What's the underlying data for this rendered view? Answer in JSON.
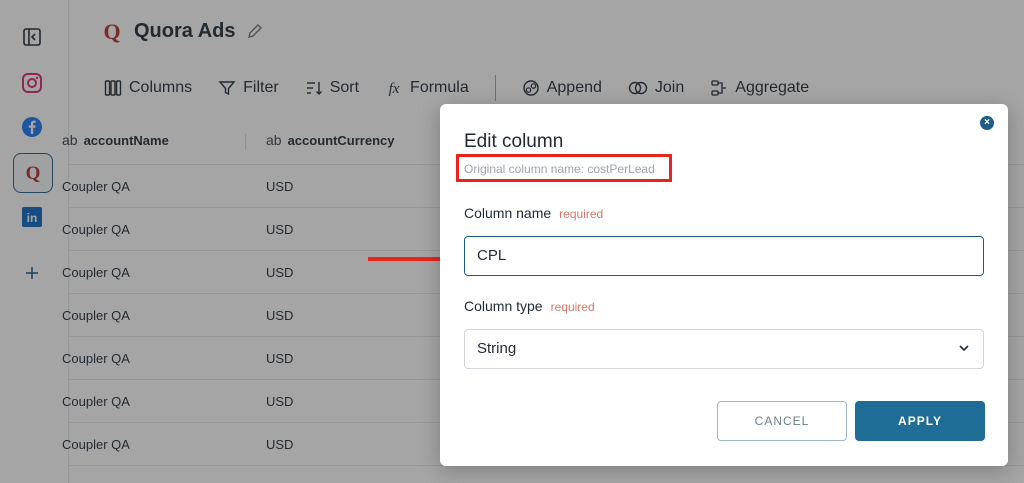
{
  "app": {
    "title": "Quora Ads"
  },
  "toolbar": {
    "columns": "Columns",
    "filter": "Filter",
    "sort": "Sort",
    "formula": "Formula",
    "append": "Append",
    "join": "Join",
    "aggregate": "Aggregate"
  },
  "table": {
    "headers": [
      {
        "type": "ab",
        "name": "accountName"
      },
      {
        "type": "ab",
        "name": "accountCurrency"
      }
    ],
    "rows": [
      {
        "accountName": "Coupler QA",
        "accountCurrency": "USD"
      },
      {
        "accountName": "Coupler QA",
        "accountCurrency": "USD"
      },
      {
        "accountName": "Coupler QA",
        "accountCurrency": "USD"
      },
      {
        "accountName": "Coupler QA",
        "accountCurrency": "USD"
      },
      {
        "accountName": "Coupler QA",
        "accountCurrency": "USD"
      },
      {
        "accountName": "Coupler QA",
        "accountCurrency": "USD"
      },
      {
        "accountName": "Coupler QA",
        "accountCurrency": "USD"
      }
    ]
  },
  "modal": {
    "title": "Edit column",
    "original": "Original column name: costPerLead",
    "name_label": "Column name",
    "type_label": "Column type",
    "required": "required",
    "name_value": "CPL",
    "type_value": "String",
    "cancel": "CANCEL",
    "apply": "APPLY"
  },
  "colors": {
    "accent": "#1f6d96",
    "highlight": "#e8241c"
  }
}
